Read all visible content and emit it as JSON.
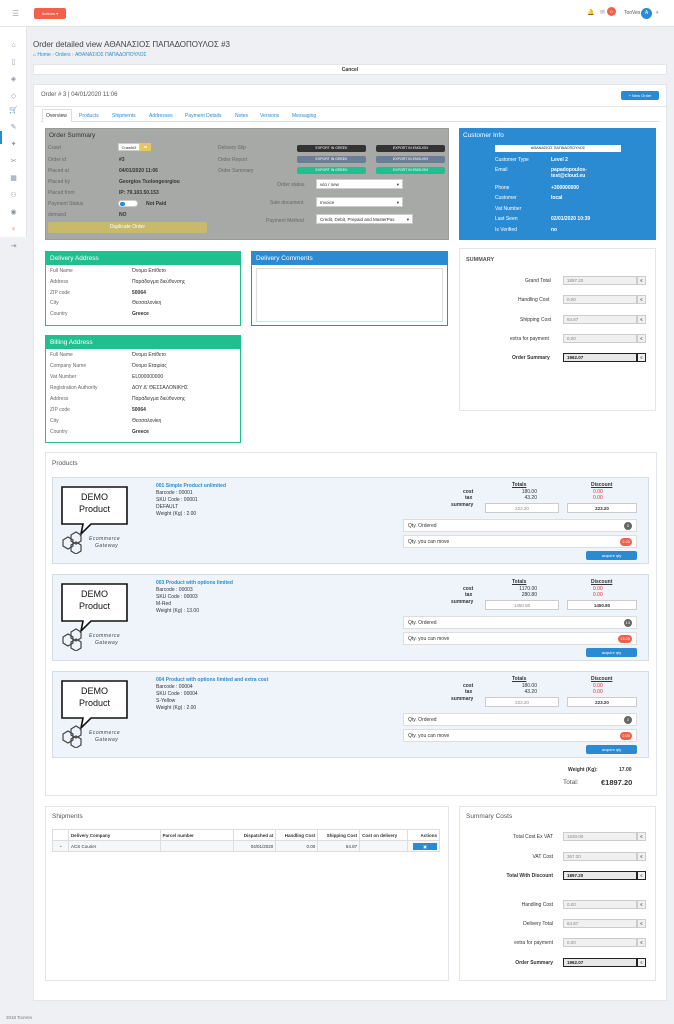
{
  "topbar": {
    "actions_label": "Actions",
    "notif_count": "0",
    "user_name": "TooVes"
  },
  "colors": {
    "accent": "#2a8bd3",
    "teal": "#1fbf8f",
    "red": "#f2604b",
    "gray_panel": "#a7a9a7",
    "olive": "#c9b96a"
  },
  "page": {
    "title": "Order detailed view ΑΘΑΝΑΣΙΟΣ ΠΑΠΑΔΟΠΟΥΛΟΣ #3",
    "breadcrumb": [
      "Home",
      "Orders",
      "ΑΘΑΝΑΣΙΟΣ ΠΑΠΑΔΟΠΟΥΛΟΣ"
    ],
    "cancel_label": "Cancel",
    "order_header": "Order # 3 | 04/01/2020 11:06",
    "new_order_label": "+ New Order",
    "footer": "2018 TooVes"
  },
  "tabs": [
    "Overview",
    "Products",
    "Shipments",
    "Addresses",
    "Payment Details",
    "Notes",
    "Versions",
    "Messaging"
  ],
  "order_summary": {
    "title": "Order Summary",
    "rows": [
      {
        "label": "Crawl",
        "value": "Crawl#3"
      },
      {
        "label": "Order id",
        "value": "#3"
      },
      {
        "label": "Placed at",
        "value": "04/01/2020 11:06"
      },
      {
        "label": "Placed by",
        "value": "Georgios Tsolongeorgiou"
      },
      {
        "label": "Placed from",
        "value": "IP: 79.103.50.153"
      },
      {
        "label": "Payment Status",
        "value": "Not Paid"
      },
      {
        "label": "demand",
        "value": "NO"
      }
    ],
    "duplicate_label": "Duplicate Order",
    "delivery_slip": "Delivery Slip",
    "order_report": "Order Report",
    "order_summary_label": "Order Summary",
    "export_greek": "EXPORT IN GREEK",
    "export_english": "EXPORT IN ENGLISH",
    "order_status_label": "Order status",
    "order_status_value": "νέα / new",
    "sale_document_label": "Sale document",
    "sale_document_value": "Invoice",
    "payment_method_label": "Payment Method",
    "payment_method_value": "Credit, Debit, Prepaid and MasterPas"
  },
  "customer_info": {
    "title": "Customer Info",
    "name": "ΑΘΑΝΑΣΙΟΣ ΠΑΠΑΔΟΠΟΥΛΟΣ",
    "rows": [
      {
        "label": "Customer Type",
        "value": "Level 2"
      },
      {
        "label": "Email",
        "value": "papadopoulos-test@cloud.eu"
      },
      {
        "label": "Phone",
        "value": "+300000000"
      },
      {
        "label": "Customer",
        "value": "local"
      },
      {
        "label": "Vat Number",
        "value": ""
      },
      {
        "label": "Last Seen",
        "value": "02/01/2020 10:39"
      },
      {
        "label": "Is Verified",
        "value": "no"
      }
    ]
  },
  "summary": {
    "title": "SUMMARY",
    "rows": [
      {
        "label": "Grand Total",
        "value": "1897.20"
      },
      {
        "label": "Handling Cost",
        "value": "0.00"
      },
      {
        "label": "Shipping Cost",
        "value": "64.87"
      },
      {
        "label": "extra for payment",
        "value": "0.00"
      },
      {
        "label": "Order Summary",
        "value": "1962.07"
      }
    ],
    "currency": "€"
  },
  "delivery_address": {
    "title": "Delivery Address",
    "rows": [
      {
        "label": "Full Name",
        "value": "Όνομα Επίθετο"
      },
      {
        "label": "Address",
        "value": "Παράδειγμα διεύθυνσης"
      },
      {
        "label": "ZIP code",
        "value": "50064"
      },
      {
        "label": "City",
        "value": "Θεσσαλονίκη"
      },
      {
        "label": "Country",
        "value": "Greece"
      }
    ]
  },
  "delivery_comments": {
    "title": "Delivery Comments"
  },
  "billing_address": {
    "title": "Billing Address",
    "rows": [
      {
        "label": "Full Name",
        "value": "Όνομα Επίθετο"
      },
      {
        "label": "Company Name",
        "value": "Όνομα Εταιρίας"
      },
      {
        "label": "Vat Number",
        "value": "EL000000000"
      },
      {
        "label": "Registration Authority",
        "value": "ΔΟΥ Δ' ΘΕΣΣΑΛΟΝΙΚΗΣ"
      },
      {
        "label": "Address",
        "value": "Παράδειγμα διεύθυνσης"
      },
      {
        "label": "ZIP code",
        "value": "50064"
      },
      {
        "label": "City",
        "value": "Θεσσαλονίκη"
      },
      {
        "label": "Country",
        "value": "Greece"
      }
    ]
  },
  "products": {
    "title": "Products",
    "totals_label": "Totals",
    "discount_label": "Discount",
    "cost_label": "cost",
    "tax_label": "tax",
    "summary_label": "summary",
    "qty_ordered_label": "Qty. Ordered",
    "qty_move_label": "Qty. you can move",
    "acquire_label": "acquire qty",
    "logo_demo": "DEMO",
    "logo_product": "Product",
    "logo_sub1": "Ecommerce",
    "logo_sub2": "Gateway",
    "items": [
      {
        "name": "001 Simple Product unlimited",
        "barcode": "Barcode : 00001",
        "sku": "SKU Code : 00001",
        "variant": "DEFAULT",
        "weight": "Weight (Kg) : 2.00",
        "cost": "180.00",
        "tax": "43.20",
        "summary": "223.20",
        "d_cost": "0.00",
        "d_tax": "0.00",
        "d_summary": "223.20",
        "qty_ordered": "2",
        "qty_move": "2.00"
      },
      {
        "name": "003 Product with options limited",
        "barcode": "Barcode : 00003",
        "sku": "SKU Code : 00003",
        "variant": "M-Red",
        "weight": "Weight (Kg) : 13.00",
        "cost": "1170.00",
        "tax": "280.80",
        "summary": "1450.80",
        "d_cost": "0.00",
        "d_tax": "0.00",
        "d_summary": "1450.80",
        "qty_ordered": "13",
        "qty_move": "13.00"
      },
      {
        "name": "004 Product with options limited and extra cost",
        "barcode": "Barcode : 00004",
        "sku": "SKU Code : 00004",
        "variant": "S-Yellow",
        "weight": "Weight (Kg) : 2.00",
        "cost": "180.00",
        "tax": "43.20",
        "summary": "223.20",
        "d_cost": "0.00",
        "d_tax": "0.00",
        "d_summary": "223.20",
        "qty_ordered": "2",
        "qty_move": "2.00"
      }
    ],
    "weight_label": "Weight (Kg):",
    "weight_value": "17.00",
    "total_label": "Total:",
    "total_value": "€1897.20"
  },
  "shipments": {
    "title": "Shipments",
    "headers": [
      "Delivery Company",
      "Parcel number",
      "Dispatched at",
      "Handling Cost",
      "Shipping Cost",
      "Cost on delivery",
      "Actions"
    ],
    "row": [
      "ACS Courier",
      "",
      "04/01/2020",
      "0.00",
      "64.87",
      "",
      ""
    ]
  },
  "summary_costs": {
    "title": "Summary Costs",
    "rows": [
      {
        "label": "Total Cost Ex VAT",
        "value": "1530.00"
      },
      {
        "label": "VAT Cost",
        "value": "367.20"
      },
      {
        "label": "Total With Discount",
        "value": "1897.20"
      },
      {
        "label": "Handling Cost",
        "value": "0.00"
      },
      {
        "label": "Delivery Total",
        "value": "64.87"
      },
      {
        "label": "extra for payment",
        "value": "0.00"
      },
      {
        "label": "Order Summary",
        "value": "1962.07"
      }
    ]
  }
}
